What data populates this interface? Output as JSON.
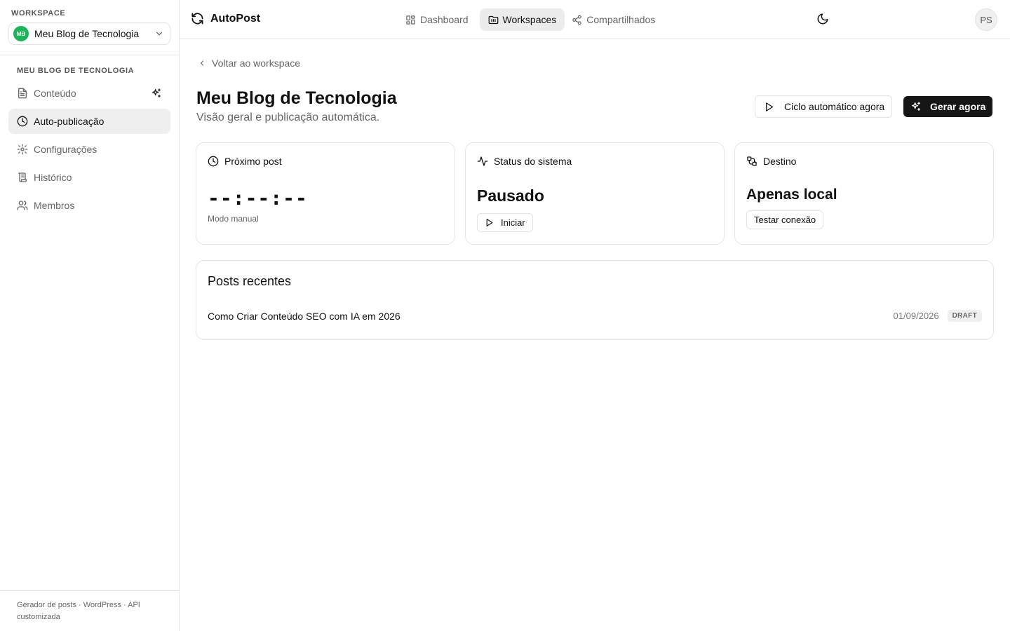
{
  "sidebar": {
    "workspace_label": "WORKSPACE",
    "workspace_initials": "MB",
    "workspace_name": "Meu Blog de Tecnologia",
    "section_heading": "MEU BLOG DE TECNOLOGIA",
    "items": [
      {
        "label": "Conteúdo",
        "icon": "document-icon"
      },
      {
        "label": "Auto-publicação",
        "icon": "clock-icon",
        "active": true
      },
      {
        "label": "Configurações",
        "icon": "gear-icon"
      },
      {
        "label": "Histórico",
        "icon": "scroll-icon"
      },
      {
        "label": "Membros",
        "icon": "users-icon"
      }
    ],
    "footer": "Gerador de posts · WordPress · API customizada"
  },
  "topbar": {
    "brand": "AutoPost",
    "nav": [
      {
        "label": "Dashboard",
        "icon": "dashboard-icon"
      },
      {
        "label": "Workspaces",
        "icon": "folder-icon",
        "active": true
      },
      {
        "label": "Compartilhados",
        "icon": "share-icon"
      }
    ],
    "user_initials": "PS"
  },
  "main": {
    "back_label": "Voltar ao workspace",
    "title": "Meu Blog de Tecnologia",
    "subtitle": "Visão geral e publicação automática.",
    "cycle_button": "Ciclo automático agora",
    "generate_button": "Gerar agora",
    "cards": {
      "next_post": {
        "title": "Próximo post",
        "countdown": "--:--:--",
        "mode": "Modo manual"
      },
      "status": {
        "title": "Status do sistema",
        "value": "Pausado",
        "button": "Iniciar"
      },
      "destination": {
        "title": "Destino",
        "value": "Apenas local",
        "button": "Testar conexão"
      }
    },
    "recent": {
      "title": "Posts recentes",
      "posts": [
        {
          "title": "Como Criar Conteúdo SEO com IA em 2026",
          "date": "01/09/2026",
          "status": "DRAFT"
        }
      ]
    }
  },
  "colors": {
    "accent_green": "#1fb45a",
    "dark_button": "#161616",
    "active_bg": "#efefef"
  }
}
